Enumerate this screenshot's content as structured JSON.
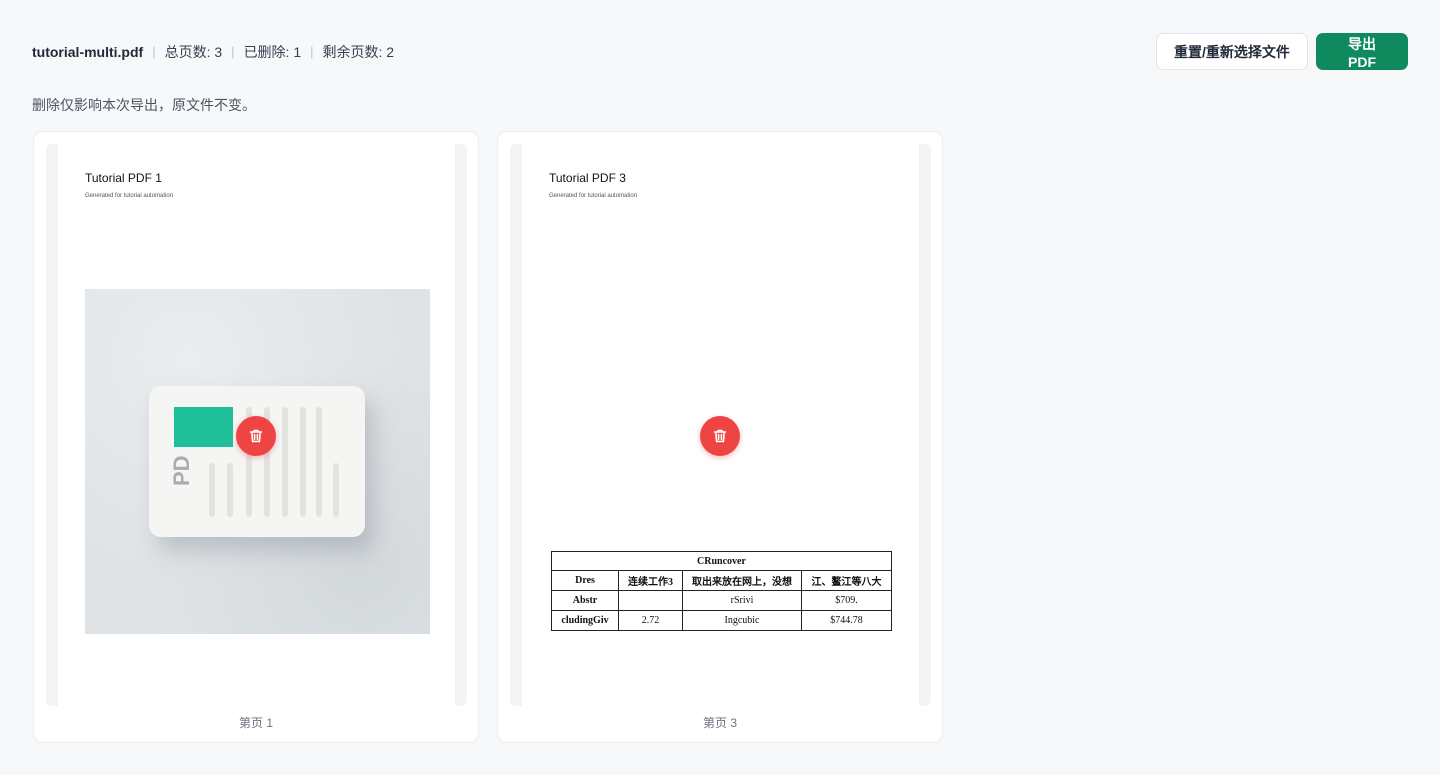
{
  "header": {
    "file_name": "tutorial-multi.pdf",
    "total_pages": "总页数: 3",
    "deleted": "已删除: 1",
    "remaining": "剩余页数: 2",
    "separator": "|"
  },
  "actions": {
    "reset_label": "重置/重新选择文件",
    "export_label": "导出 PDF",
    "export_color": "#0f8a5f"
  },
  "note": "删除仅影响本次导出，原文件不变。",
  "delete_color": "#ef4444",
  "pages": [
    {
      "title": "Tutorial PDF 1",
      "subtitle": "Generated for tutorial automation",
      "illustration_label": "PD",
      "caption": "第页 1",
      "delete_icon": "trash-icon"
    },
    {
      "title": "Tutorial PDF 3",
      "subtitle": "Generated for tutorial automation",
      "caption": "第页 3",
      "delete_icon": "trash-icon",
      "table": {
        "caption": "CRuncover",
        "headers": [
          "Dres",
          "连续工作3",
          "取出来放在网上，没想",
          "江、鳌江等八大"
        ],
        "rows": [
          [
            "Abstr",
            "",
            "rSrivi",
            "$709."
          ],
          [
            "cludingGiv",
            "2.72",
            "Ingcubic",
            "$744.78"
          ]
        ]
      }
    }
  ]
}
